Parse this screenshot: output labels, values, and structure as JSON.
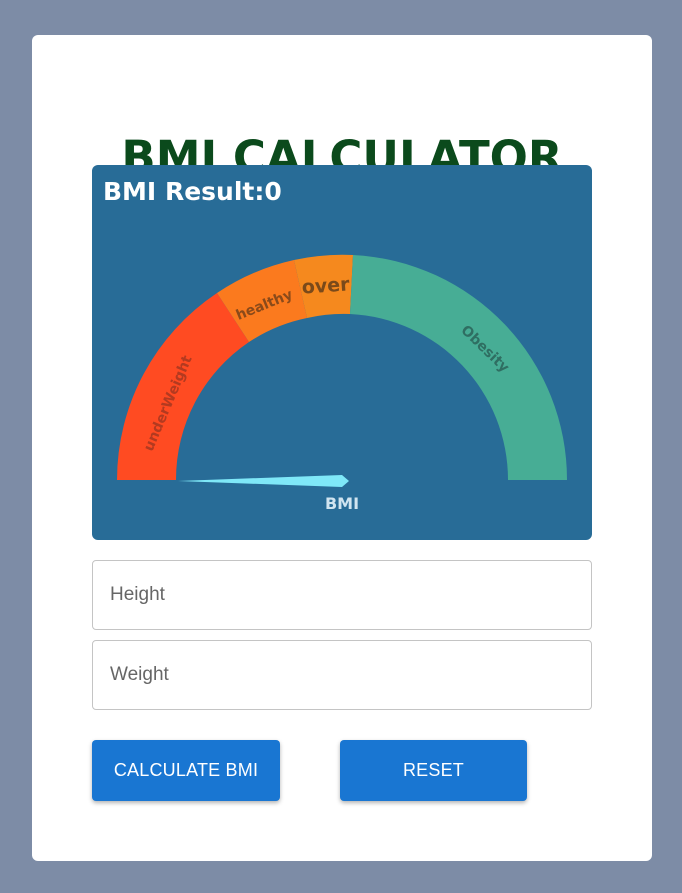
{
  "title": "BMI CALCULATOR",
  "gauge": {
    "result_label": "BMI Result:0",
    "value": 0,
    "bmi_label": "BMI",
    "segments": [
      {
        "label": "underWeight",
        "color": "#ff4b22"
      },
      {
        "label": "healthy",
        "color": "#fb7a1e"
      },
      {
        "label": "over",
        "color": "#f5891e"
      },
      {
        "label": "Obesity",
        "color": "#47ad95"
      }
    ],
    "needle_color": "#7fe8f8",
    "panel_color": "#286c97"
  },
  "inputs": {
    "height_placeholder": "Height",
    "weight_placeholder": "Weight"
  },
  "buttons": {
    "calculate_label": "CALCULATE BMI",
    "reset_label": "RESET"
  }
}
